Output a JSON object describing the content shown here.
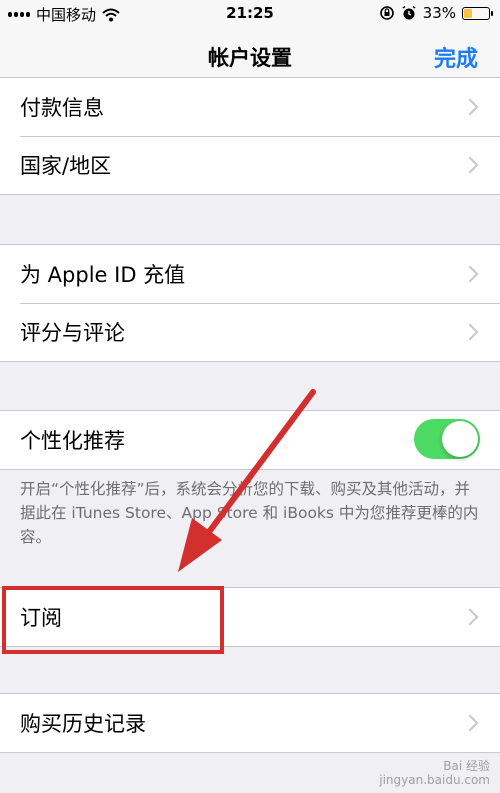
{
  "status_bar": {
    "carrier": "中国移动",
    "time": "21:25",
    "battery_percent": "33%",
    "battery_level": 0.33,
    "icons": [
      "signal-icon",
      "wifi-icon",
      "lock-rotation-icon",
      "alarm-icon",
      "battery-icon"
    ]
  },
  "nav": {
    "title": "帐户设置",
    "done": "完成"
  },
  "group1": {
    "items": [
      {
        "label": "付款信息"
      },
      {
        "label": "国家/地区"
      }
    ]
  },
  "group2": {
    "items": [
      {
        "label": "为 Apple ID 充值"
      },
      {
        "label": "评分与评论"
      }
    ]
  },
  "group3": {
    "label": "个性化推荐",
    "toggle_on": true,
    "footer": "开启“个性化推荐”后，系统会分析您的下载、购买及其他活动，并据此在 iTunes Store、App Store 和 iBooks 中为您推荐更棒的内容。"
  },
  "group4": {
    "items": [
      {
        "label": "订阅"
      }
    ]
  },
  "group5": {
    "items": [
      {
        "label": "购买历史记录"
      }
    ]
  },
  "annotation": {
    "color": "#d32f2f"
  },
  "watermark": {
    "line1": "Bai 经验",
    "line2": "jingyan.baidu.com"
  },
  "colors": {
    "accent": "#1e7cf2",
    "toggle_on": "#4cd964",
    "background": "#efeff4"
  }
}
